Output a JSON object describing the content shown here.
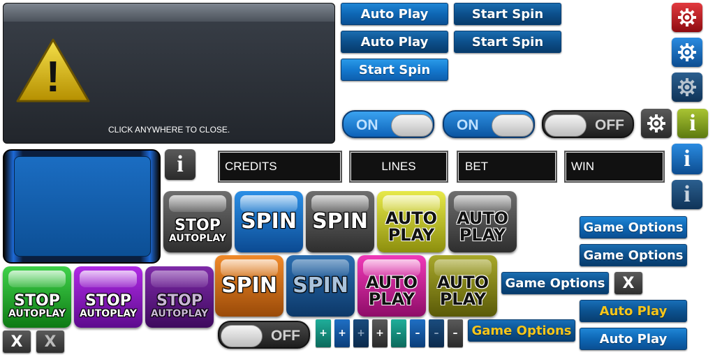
{
  "dialog": {
    "message": "CLICK ANYWHERE TO CLOSE.",
    "warning_glyph": "!"
  },
  "buttons": {
    "auto_play": "Auto Play",
    "start_spin": "Start Spin",
    "game_options": "Game Options"
  },
  "toggles": {
    "on": "ON",
    "off": "OFF"
  },
  "info_glyph": "i",
  "stats": {
    "credits": "CREDITS",
    "lines": "LINES",
    "bet": "BET",
    "win": "WIN"
  },
  "tiles": {
    "stop": "STOP",
    "autoplay": "AUTOPLAY",
    "spin": "SPIN",
    "auto": "AUTO",
    "play": "PLAY"
  },
  "close_glyph": "X",
  "plus": "+",
  "minus": "–",
  "colors": {
    "blue": "#0e67b4",
    "gold_text": "#f7c61b",
    "red_gear": "#c0141a",
    "green_info": "#7a9a1a",
    "panel": "#2b3038"
  },
  "icons": [
    "warning-icon",
    "gear-icon",
    "info-icon",
    "close-icon",
    "plus-icon",
    "minus-icon"
  ]
}
